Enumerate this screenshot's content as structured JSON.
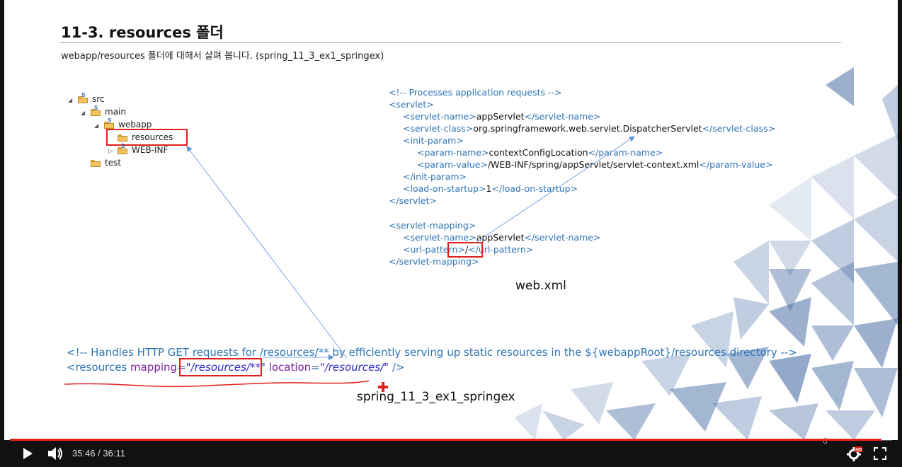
{
  "slide": {
    "title": "11-3. resources 폴더",
    "subtitle": "webapp/resources 폴더에 대해서 살펴 봅니다. (spring_11_3_ex1_springex)",
    "tree": {
      "src": "src",
      "main": "main",
      "webapp": "webapp",
      "resources": "resources",
      "webinf": "WEB-INF",
      "test": "test"
    },
    "webxml": {
      "l1": "<!-- Processes application requests -->",
      "l2": "<servlet>",
      "l3a": "<servlet-name>",
      "l3b": "appServlet",
      "l3c": "</servlet-name>",
      "l4a": "<servlet-class>",
      "l4b": "org.springframework.web.servlet.DispatcherServlet",
      "l4c": "</servlet-class>",
      "l5": "<init-param>",
      "l6a": "<param-name>",
      "l6b": "contextConfigLocation",
      "l6c": "</param-name>",
      "l7a": "<param-value>",
      "l7b": "/WEB-INF/spring/appServlet/servlet-context.xml",
      "l7c": "</param-value>",
      "l8": "</init-param>",
      "l9a": "<load-on-startup>",
      "l9b": "1",
      "l9c": "</load-on-startup>",
      "l10": "</servlet>",
      "l11": "<servlet-mapping>",
      "l12a": "<servlet-name>",
      "l12b": "appServlet",
      "l12c": "</servlet-name>",
      "l13a": "<url-pattern>",
      "l13b": "/",
      "l13c": "</url-pattern>",
      "l14": "</servlet-mapping>",
      "caption": "web.xml"
    },
    "resourcesComment": "<!-- Handles HTTP GET requests for /resources/** by efficiently serving up static resources in the ${webappRoot}/resources directory -->",
    "resourcesTag": {
      "open": "<resources ",
      "mappingAttr": "mapping",
      "eq1": "=",
      "mappingVal": "\"/resources/**\"",
      "locationAttr": " location",
      "eq2": "=",
      "locationVal": "\"/resources/\"",
      "close": " />"
    },
    "projectCaption": "spring_11_3_ex1_springex",
    "pageNumber": "6"
  },
  "player": {
    "currentTime": "35:46",
    "separator": " / ",
    "duration": "36:11",
    "progress": 0.988,
    "colors": {
      "progress": "#e62117",
      "hdBadge": "#e62117"
    }
  }
}
